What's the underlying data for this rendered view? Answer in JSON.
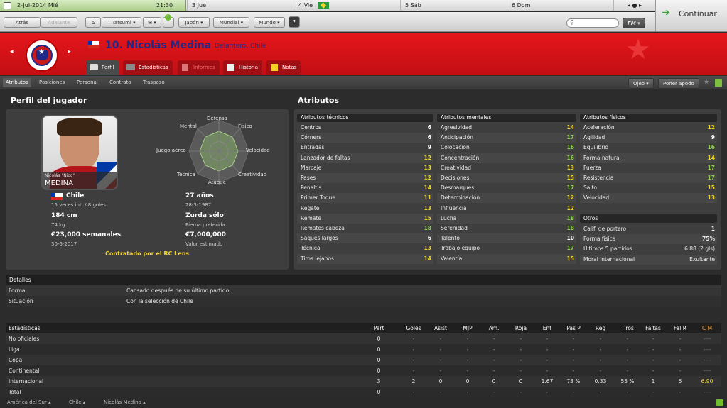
{
  "calendar": {
    "current_date": "2-Jul-2014 Mié",
    "time": "21:30",
    "days": [
      "3 Jue",
      "4 Vie",
      "5 Sáb",
      "6 Dom"
    ]
  },
  "nav": {
    "back": "Atrás",
    "forward": "Adelante",
    "manager": "T Tatsumi",
    "menus": [
      "Japón",
      "Mundial",
      "Mundo"
    ],
    "help": "?",
    "search_placeholder": "",
    "fm_menu": "FM",
    "badge": "1"
  },
  "continue_label": "Continuar",
  "player": {
    "title": "10. Nicolás Medina",
    "subtitle": "Delantero, Chile"
  },
  "tabs": [
    "Perfil",
    "Estadísticas",
    "Informes",
    "Historia",
    "Notas"
  ],
  "subnav": {
    "items": [
      "Atributos",
      "Posiciones",
      "Personal",
      "Contrato",
      "Traspaso"
    ],
    "scout": "Ojeo",
    "nickname": "Poner apodo"
  },
  "profile": {
    "heading": "Perfil del jugador",
    "photo_caption_small": "Nicolás \"Nico\"",
    "photo_caption": "MEDINA",
    "nation": "Chile",
    "caps": "15 veces int. / 8 goles",
    "age": "27 años",
    "dob": "28-3-1987",
    "height": "184 cm",
    "weight": "74 kg",
    "foot": "Zurda sólo",
    "foot_label": "Pierna preferida",
    "wage": "€23,000 semanales",
    "contract_end": "30-6-2017",
    "value": "€7,000,000",
    "value_label": "Valor estimado",
    "contract_note": "Contratado por el RC Lens",
    "radar_labels": {
      "top": "Defensa",
      "top_left": "Mental",
      "top_right": "Físico",
      "left": "Juego aéreo",
      "right": "Velocidad",
      "bottom_left": "Técnica",
      "bottom_right": "Creatividad",
      "bottom": "Ataque"
    }
  },
  "attributes": {
    "heading": "Atributos",
    "technical_title": "Atributos técnicos",
    "technical": [
      {
        "name": "Centros",
        "value": "6"
      },
      {
        "name": "Córners",
        "value": "6"
      },
      {
        "name": "Entradas",
        "value": "9"
      },
      {
        "name": "Lanzador de faltas",
        "value": "12"
      },
      {
        "name": "Marcaje",
        "value": "13"
      },
      {
        "name": "Pases",
        "value": "12"
      },
      {
        "name": "Penaltis",
        "value": "14"
      },
      {
        "name": "Primer Toque",
        "value": "11"
      },
      {
        "name": "Regate",
        "value": "13"
      },
      {
        "name": "Remate",
        "value": "15"
      },
      {
        "name": "Remates cabeza",
        "value": "18"
      },
      {
        "name": "Saques largos",
        "value": "6"
      },
      {
        "name": "Técnica",
        "value": "13"
      },
      {
        "name": "Tiros lejanos",
        "value": "14"
      }
    ],
    "mental_title": "Atributos mentales",
    "mental": [
      {
        "name": "Agresividad",
        "value": "14"
      },
      {
        "name": "Anticipación",
        "value": "17"
      },
      {
        "name": "Colocación",
        "value": "16"
      },
      {
        "name": "Concentración",
        "value": "16"
      },
      {
        "name": "Creatividad",
        "value": "13"
      },
      {
        "name": "Decisiones",
        "value": "15"
      },
      {
        "name": "Desmarques",
        "value": "17"
      },
      {
        "name": "Determinación",
        "value": "12"
      },
      {
        "name": "Influencia",
        "value": "12"
      },
      {
        "name": "Lucha",
        "value": "18"
      },
      {
        "name": "Serenidad",
        "value": "18"
      },
      {
        "name": "Talento",
        "value": "10"
      },
      {
        "name": "Trabajo equipo",
        "value": "17"
      },
      {
        "name": "Valentía",
        "value": "15"
      }
    ],
    "physical_title": "Atributos físicos",
    "physical": [
      {
        "name": "Aceleración",
        "value": "12"
      },
      {
        "name": "Agilidad",
        "value": "9"
      },
      {
        "name": "Equilibrio",
        "value": "16"
      },
      {
        "name": "Forma natural",
        "value": "14"
      },
      {
        "name": "Fuerza",
        "value": "17"
      },
      {
        "name": "Resistencia",
        "value": "17"
      },
      {
        "name": "Salto",
        "value": "15"
      },
      {
        "name": "Velocidad",
        "value": "13"
      }
    ],
    "other_title": "Otros",
    "other": [
      {
        "name": "Calif. de portero",
        "value": "1"
      },
      {
        "name": "Forma física",
        "value": "75%"
      },
      {
        "name": "Últimos 5 partidos",
        "value": "6.88 (2 gls)"
      },
      {
        "name": "Moral internacional",
        "value": "Exultante"
      }
    ]
  },
  "details": {
    "title": "Detalles",
    "rows": [
      {
        "label": "Forma",
        "value": "Cansado después de su último partido"
      },
      {
        "label": "Situación",
        "value": "Con la selección de Chile"
      }
    ]
  },
  "stats": {
    "title": "Estadísticas",
    "columns": [
      "Part",
      "Goles",
      "Asist",
      "MJP",
      "Am.",
      "Roja",
      "Ent",
      "Pas P",
      "Reg",
      "Tiros",
      "Faltas",
      "Fal R",
      "C M"
    ],
    "rows": [
      {
        "name": "No oficiales",
        "cells": [
          "0",
          "-",
          "-",
          "-",
          "-",
          "-",
          "-",
          "-",
          "-",
          "-",
          "-",
          "-",
          "----"
        ]
      },
      {
        "name": "Liga",
        "cells": [
          "0",
          "-",
          "-",
          "-",
          "-",
          "-",
          "-",
          "-",
          "-",
          "-",
          "-",
          "-",
          "----"
        ]
      },
      {
        "name": "Copa",
        "cells": [
          "0",
          "-",
          "-",
          "-",
          "-",
          "-",
          "-",
          "-",
          "-",
          "-",
          "-",
          "-",
          "----"
        ]
      },
      {
        "name": "Continental",
        "cells": [
          "0",
          "-",
          "-",
          "-",
          "-",
          "-",
          "-",
          "-",
          "-",
          "-",
          "-",
          "-",
          "----"
        ]
      },
      {
        "name": "Internacional",
        "cells": [
          "3",
          "2",
          "0",
          "0",
          "0",
          "0",
          "1.67",
          "73 %",
          "0.33",
          "55 %",
          "1",
          "5",
          "6.90"
        ]
      },
      {
        "name": "Total",
        "cells": [
          "0",
          "-",
          "-",
          "-",
          "-",
          "-",
          "-",
          "-",
          "-",
          "-",
          "-",
          "-",
          "----"
        ]
      }
    ]
  },
  "footer": {
    "crumbs": [
      "América del Sur",
      "Chile",
      "Nicolás Medina"
    ]
  },
  "colors": {
    "brand_red": "#d4121a",
    "high": "#f0d52a",
    "very_high": "#8fd14f",
    "normal": "#ffffff",
    "title_blue": "#1d2a8a"
  }
}
